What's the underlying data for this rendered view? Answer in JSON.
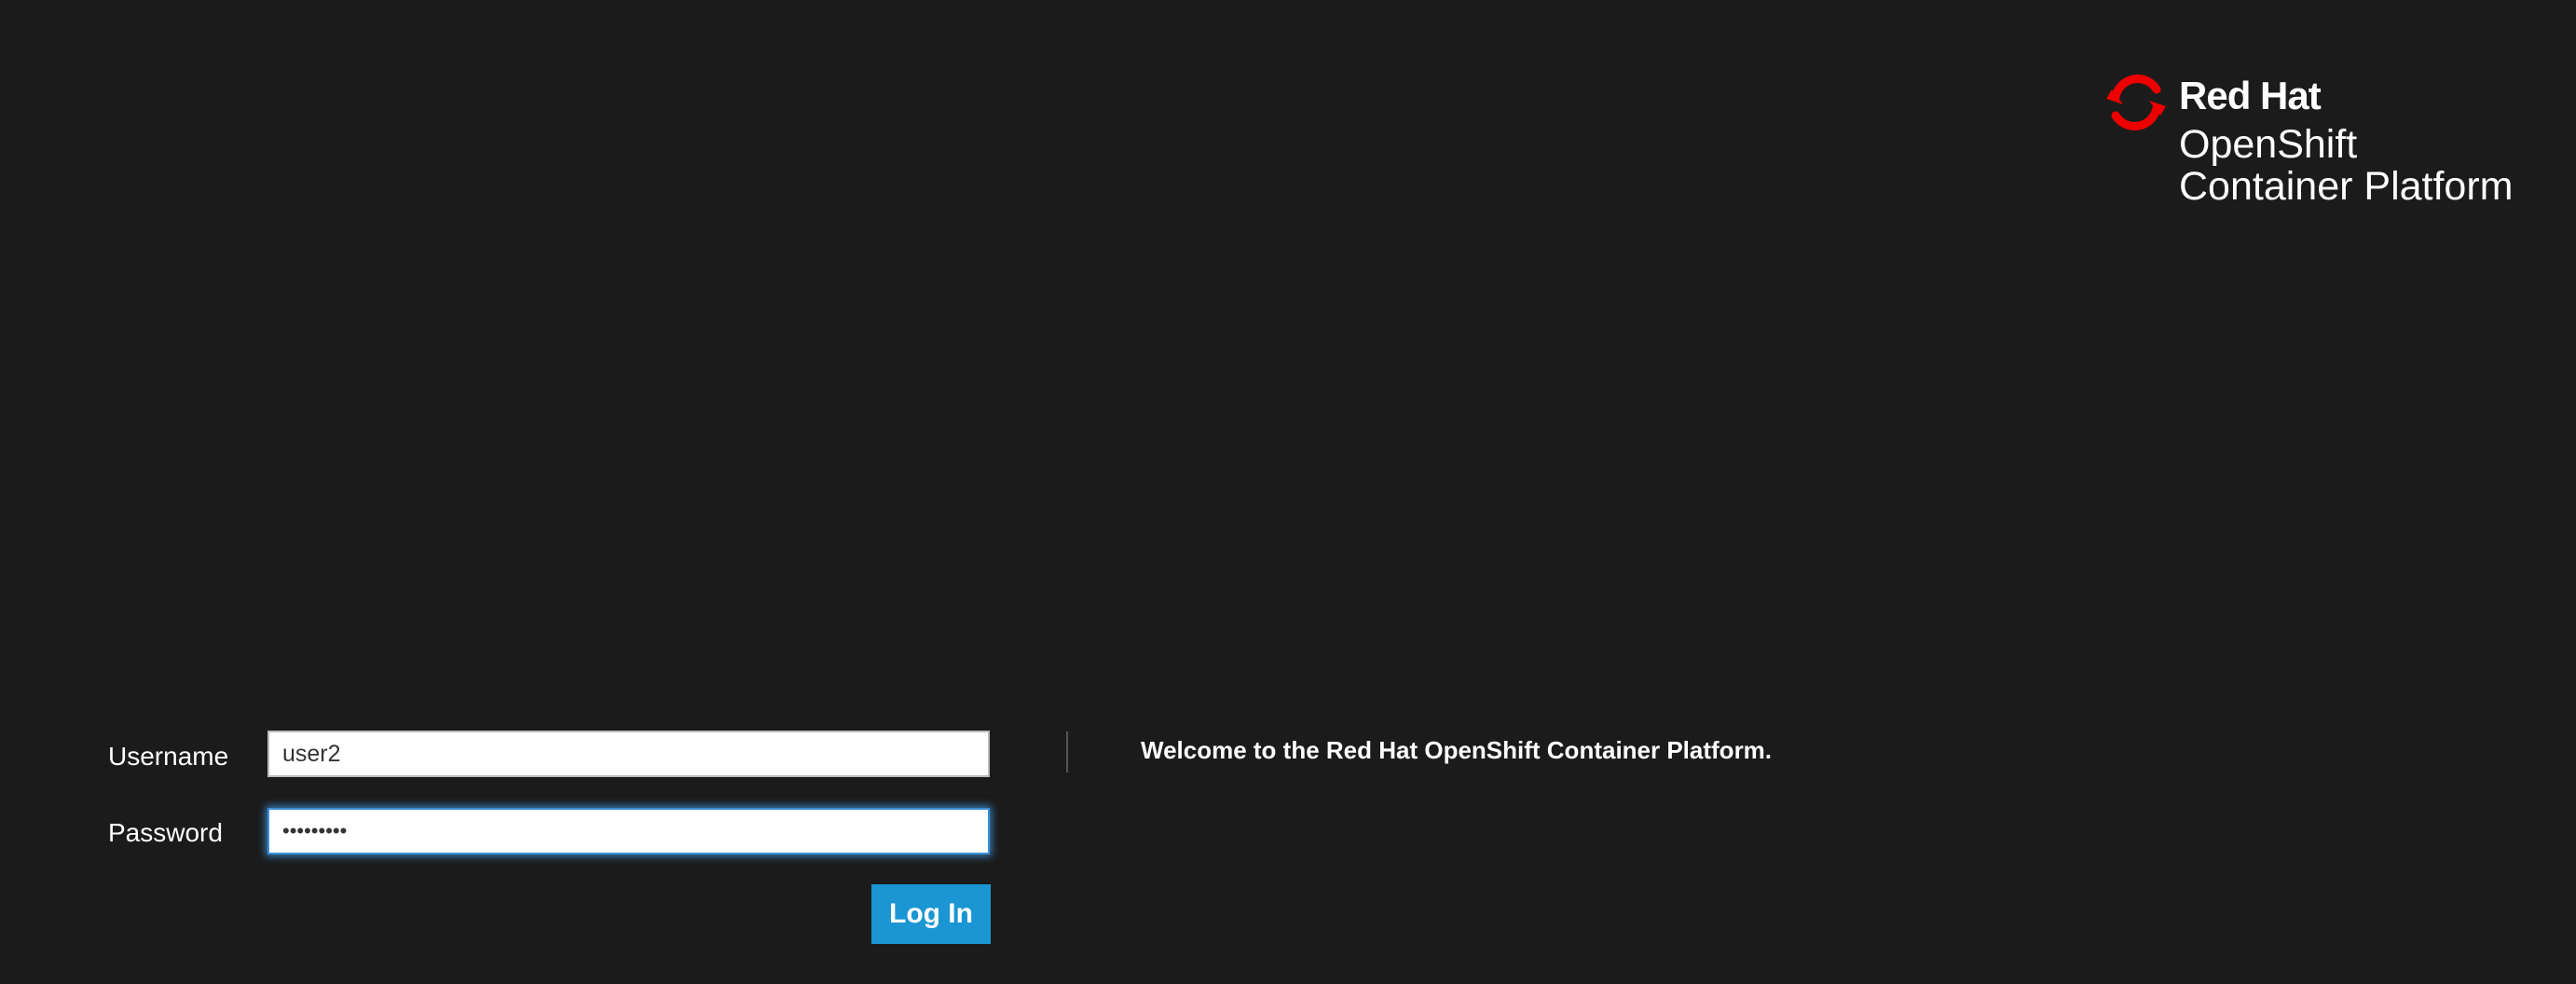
{
  "brand": {
    "logo_icon": "red-hat-icon",
    "accent_color": "#ee0000",
    "company": "Red Hat",
    "product_line1": "OpenShift",
    "product_line2": "Container Platform"
  },
  "login": {
    "username_label": "Username",
    "username_value": "user2",
    "password_label": "Password",
    "password_value": "•••••••••",
    "login_button_label": "Log In",
    "button_color": "#1b96d3"
  },
  "welcome": {
    "message": "Welcome to the Red Hat OpenShift Container Platform."
  }
}
